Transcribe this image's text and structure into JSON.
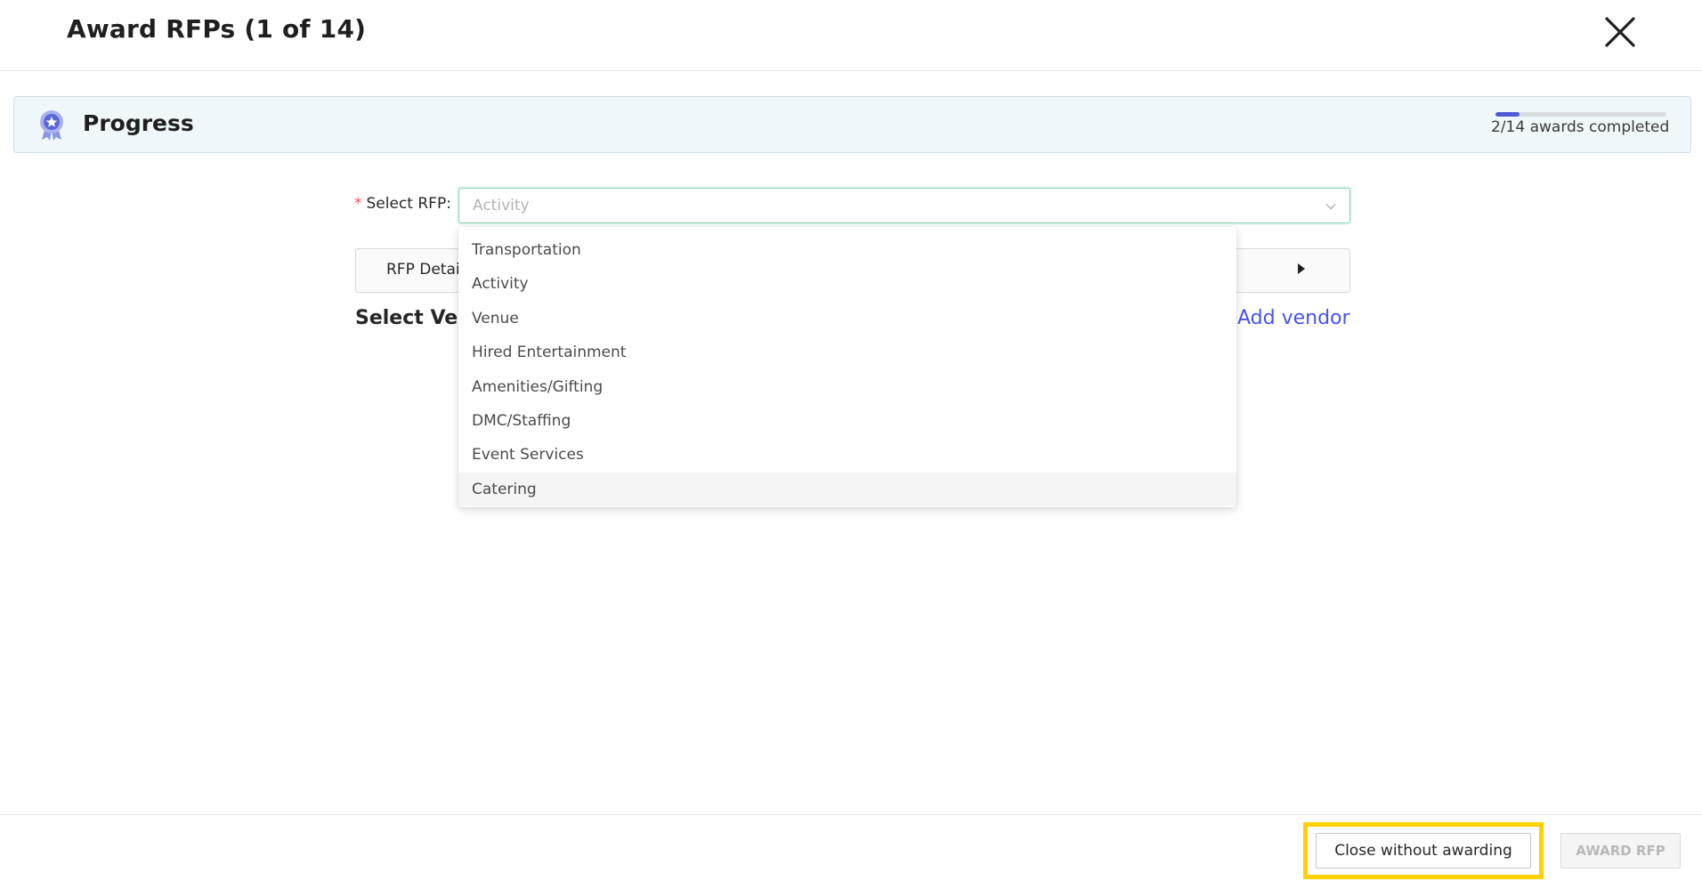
{
  "header": {
    "title": "Award RFPs (1 of 14)"
  },
  "progress": {
    "label": "Progress",
    "completed_text": "2/14 awards completed",
    "fraction": 0.143,
    "accent_color": "#4f5bd5"
  },
  "form": {
    "required_mark": "*",
    "select_label": "Select RFP:",
    "select_value": "Activity"
  },
  "dropdown": {
    "options": [
      "Transportation",
      "Activity",
      "Venue",
      "Hired Entertainment",
      "Amenities/Gifting",
      "DMC/Staffing",
      "Event Services",
      "Catering"
    ]
  },
  "details": {
    "panel_title": "RFP Detail"
  },
  "vendors": {
    "section_title": "Select Ven",
    "add_label": "Add vendor",
    "link_color": "#4754e8"
  },
  "footer": {
    "close_label": "Close without awarding",
    "award_label": "AWARD RFP",
    "highlight_color": "#ffd000"
  }
}
